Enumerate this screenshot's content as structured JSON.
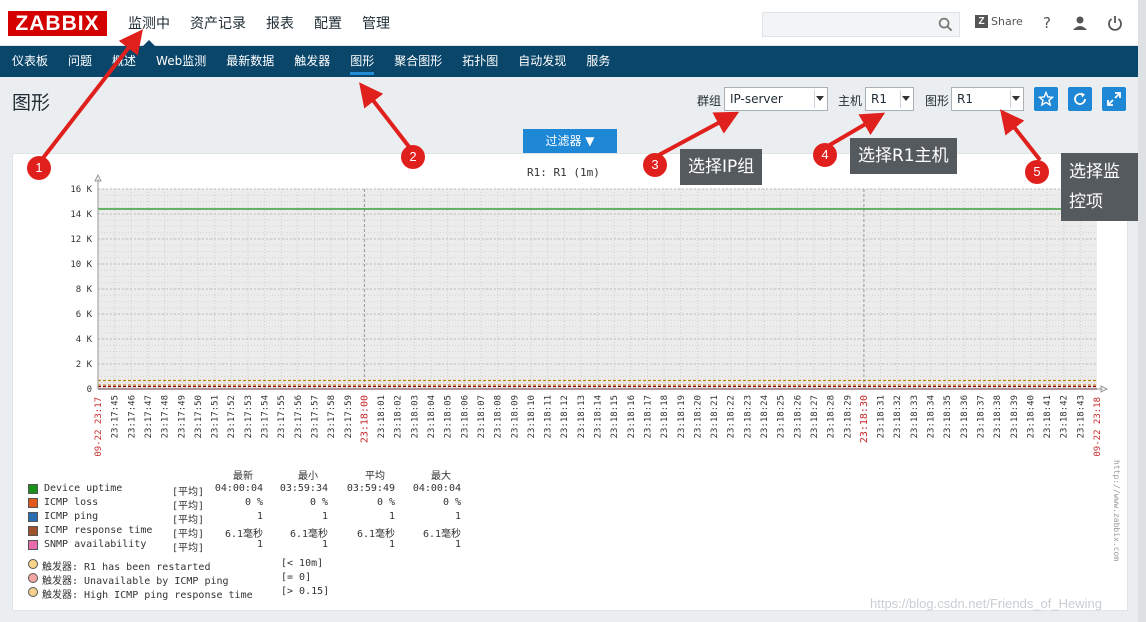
{
  "header": {
    "logo": "ZABBIX",
    "nav": [
      "监测中",
      "资产记录",
      "报表",
      "配置",
      "管理"
    ],
    "share_label": "Share",
    "help_glyph": "?"
  },
  "subnav": [
    "仪表板",
    "问题",
    "概述",
    "Web监测",
    "最新数据",
    "触发器",
    "图形",
    "聚合图形",
    "拓扑图",
    "自动发现",
    "服务"
  ],
  "page": {
    "title": "图形",
    "group_label": "群组",
    "group_value": "IP-server",
    "host_label": "主机",
    "host_value": "R1",
    "graph_label": "图形",
    "graph_value": "R1",
    "filter_label": "过滤器 ▼"
  },
  "chart_data": {
    "type": "line",
    "title": "R1: R1 (1m)",
    "yticks": [
      "16 K",
      "14 K",
      "12 K",
      "10 K",
      "8 K",
      "6 K",
      "4 K",
      "2 K",
      "0"
    ],
    "ylim": [
      0,
      16000
    ],
    "grid": true,
    "x_start_label": "09-22 23:17",
    "x_end_label": "09-22 23:18",
    "xticks": [
      "23:17:45",
      "23:17:46",
      "23:17:47",
      "23:17:48",
      "23:17:49",
      "23:17:50",
      "23:17:51",
      "23:17:52",
      "23:17:53",
      "23:17:54",
      "23:17:55",
      "23:17:56",
      "23:17:57",
      "23:17:58",
      "23:17:59",
      "23:18:00",
      "23:18:01",
      "23:18:02",
      "23:18:03",
      "23:18:04",
      "23:18:05",
      "23:18:06",
      "23:18:07",
      "23:18:08",
      "23:18:09",
      "23:18:10",
      "23:18:11",
      "23:18:12",
      "23:18:13",
      "23:18:14",
      "23:18:15",
      "23:18:16",
      "23:18:17",
      "23:18:18",
      "23:18:19",
      "23:18:20",
      "23:18:21",
      "23:18:22",
      "23:18:23",
      "23:18:24",
      "23:18:25",
      "23:18:26",
      "23:18:27",
      "23:18:28",
      "23:18:29",
      "23:18:30",
      "23:18:31",
      "23:18:32",
      "23:18:33",
      "23:18:34",
      "23:18:35",
      "23:18:36",
      "23:18:37",
      "23:18:38",
      "23:18:39",
      "23:18:40",
      "23:18:41",
      "23:18:42",
      "23:18:43"
    ],
    "highlight_ticks": [
      "23:18:00",
      "23:18:30"
    ],
    "series": [
      {
        "name": "Device uptime",
        "color": "#1a8f1a",
        "value": 14400
      },
      {
        "name": "ICMP loss",
        "color": "#e05a1c",
        "value": 0
      },
      {
        "name": "ICMP ping",
        "color": "#2a6db5",
        "value": 1
      },
      {
        "name": "ICMP response time",
        "color": "#a0522d",
        "value": 0.0061
      },
      {
        "name": "SNMP availability",
        "color": "#e56cb0",
        "value": 1
      }
    ],
    "triggers": [
      {
        "value": 600,
        "color": "#b8860b"
      },
      {
        "value": 0,
        "color": "#8b0000"
      },
      {
        "value": 0.15,
        "color": "#cd853f"
      }
    ]
  },
  "legend": {
    "headers": [
      "最新",
      "最小",
      "平均",
      "最大"
    ],
    "rows": [
      {
        "name": "Device uptime",
        "fn": "[平均]",
        "last": "04:00:04",
        "min": "03:59:34",
        "avg": "03:59:49",
        "max": "04:00:04",
        "color": "#1a8f1a"
      },
      {
        "name": "ICMP loss",
        "fn": "[平均]",
        "last": "0 %",
        "min": "0 %",
        "avg": "0 %",
        "max": "0 %",
        "color": "#e05a1c"
      },
      {
        "name": "ICMP ping",
        "fn": "[平均]",
        "last": "1",
        "min": "1",
        "avg": "1",
        "max": "1",
        "color": "#2a6db5"
      },
      {
        "name": "ICMP response time",
        "fn": "[平均]",
        "last": "6.1毫秒",
        "min": "6.1毫秒",
        "avg": "6.1毫秒",
        "max": "6.1毫秒",
        "color": "#a0522d"
      },
      {
        "name": "SNMP availability",
        "fn": "[平均]",
        "last": "1",
        "min": "1",
        "avg": "1",
        "max": "1",
        "color": "#e56cb0"
      }
    ],
    "triggers": [
      {
        "text": "触发器: R1 has been restarted",
        "cond": "[< 10m]",
        "color": "#f7d48a"
      },
      {
        "text": "触发器: Unavailable by ICMP ping",
        "cond": "[= 0]",
        "color": "#f4a7a0"
      },
      {
        "text": "触发器: High ICMP ping response time",
        "cond": "[> 0.15]",
        "color": "#f7cf8e"
      }
    ]
  },
  "zabbix_url": "http://www.zabbix.com",
  "annotations": {
    "n1": "1",
    "n2": "2",
    "n3": "3",
    "n4": "4",
    "n5": "5",
    "t3": "选择IP组",
    "t4": "选择R1主机",
    "t5a": "选择监",
    "t5b": "控项"
  },
  "watermark": "https://blog.csdn.net/Friends_of_Hewing"
}
